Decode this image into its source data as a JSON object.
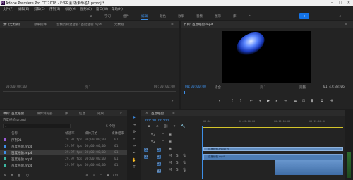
{
  "app": {
    "title": "Adobe Premiere Pro CC 2018 - F:\\PR素材\\未命名1.prproj *",
    "logo": "Pr"
  },
  "menu": [
    "文件(F)",
    "编辑(E)",
    "剪辑(C)",
    "序列(S)",
    "标记(M)",
    "图形(G)",
    "窗口(W)",
    "帮助(H)"
  ],
  "workspaces": {
    "items": [
      "学习",
      "组件",
      "编辑",
      "颜色",
      "效果",
      "音频",
      "图形",
      "库"
    ],
    "active_index": 2,
    "more": "»"
  },
  "source_panel": {
    "tabs": [
      "源: (无剪辑)",
      "效果控件",
      "音频剪辑混合器: 百度经验.mp4",
      "元数据"
    ],
    "tab_more": "≡",
    "timecode_left": "00;00;00;00",
    "timecode_right": "00;00;00;00",
    "page_label": "页 1",
    "expand": "»"
  },
  "program_panel": {
    "tab": "节目: 百度经验.mp4",
    "tab_menu": "≡",
    "timecode": "00:00:00:00",
    "fit": "适合",
    "quality": "完整",
    "duration": "01:47:38:06",
    "page_label": "页 1"
  },
  "project_panel": {
    "tabs": [
      "项目: 百度经验",
      "媒体浏览器",
      "库",
      "信息",
      "效果"
    ],
    "more": "»",
    "project_file": "百度经验.prproj",
    "item_count": "5 个项",
    "columns": [
      "名称",
      "帧速率",
      "媒体开始",
      "媒体结束"
    ],
    "items": [
      {
        "name": "序列01",
        "fps": "29.97 fps",
        "start": "00;00;00;00",
        "end": "01",
        "color": "#9b59d6"
      },
      {
        "name": "百度经验.mp4",
        "fps": "29.97 fps",
        "start": "00;00;00;00",
        "end": "01",
        "color": "#3d8ee6"
      },
      {
        "name": "百度经验.mp4",
        "fps": "29.97 fps",
        "start": "00;00;00;00",
        "end": "01",
        "color": "#3d8ee6"
      },
      {
        "name": "百度经验.mp4",
        "fps": "29.97 fps",
        "start": "00;00;00;00",
        "end": "01",
        "color": "#3cb7a0"
      },
      {
        "name": "百度经验.mp4",
        "fps": "29.97 fps",
        "start": "00;00;00;00",
        "end": "01",
        "color": "#3cb7a0"
      }
    ]
  },
  "timeline": {
    "tab": "百度经验",
    "tab_menu": "≡",
    "timecode": "00:00:00:00",
    "ruler": [
      "00:00",
      "00:05:00:00",
      "00:10:00:00",
      "00:15:00:00"
    ],
    "tracks": [
      {
        "id": "V3"
      },
      {
        "id": "V2"
      },
      {
        "id": "V1"
      },
      {
        "id": "A1"
      },
      {
        "id": "A2"
      },
      {
        "id": "A3"
      }
    ],
    "video_clip_label": "百度经验.mp4 [V]",
    "audio_clip_label": "百度经验.mp4"
  },
  "colors": {
    "accent": "#3d8ee6",
    "clip_video": "#5f8bbf",
    "clip_audio": "#4d7cb4",
    "playhead": "#3d8ee6",
    "work_area": "#d3c42a"
  }
}
